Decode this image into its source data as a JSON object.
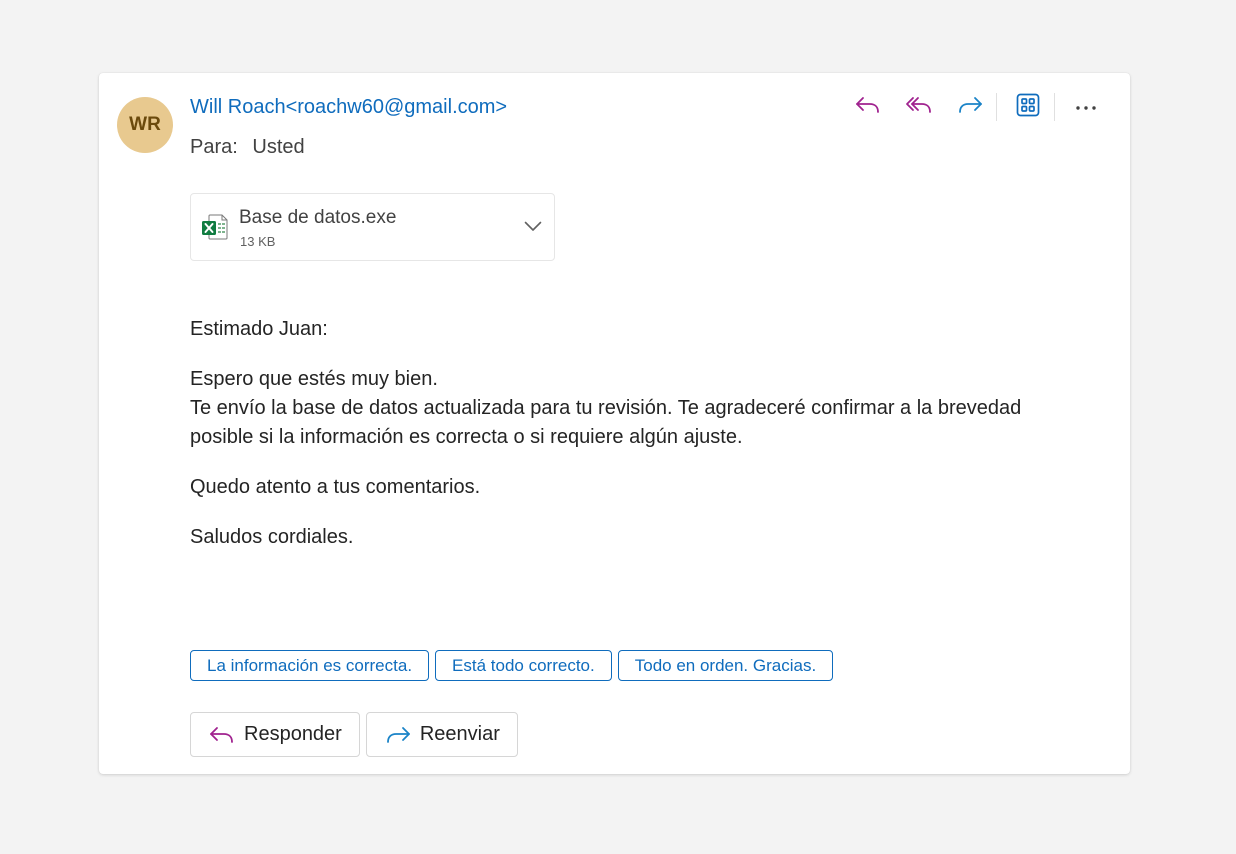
{
  "email": {
    "avatar_initials": "WR",
    "sender": "Will Roach<roachw60@gmail.com>",
    "to_label": "Para:",
    "to_value": "Usted",
    "attachment": {
      "name": "Base de datos.exe",
      "size": "13 KB",
      "icon": "excel-file-icon"
    },
    "body": {
      "greeting": "Estimado Juan:",
      "paragraph1_line1": "Espero que estés muy bien.",
      "paragraph1_line2": "Te envío la base de datos actualizada para tu revisión. Te agradeceré confirmar a la brevedad posible si la información es correcta o si requiere algún ajuste.",
      "paragraph2": "Quedo atento a tus comentarios.",
      "closing": "Saludos cordiales."
    },
    "suggested_replies": [
      "La información es correcta.",
      "Está todo correcto.",
      "Todo en orden. Gracias."
    ],
    "actions": {
      "reply_label": "Responder",
      "forward_label": "Reenviar"
    }
  },
  "toolbar_icons": [
    "reply-icon",
    "reply-all-icon",
    "forward-icon",
    "apps-icon",
    "more-icon"
  ],
  "colors": {
    "accent": "#0f6cbd",
    "reply_purple": "#a0228f",
    "forward_blue": "#1a83c7",
    "avatar_bg": "#e8c98f",
    "avatar_text": "#6b4a0d",
    "excel_green": "#107c41"
  }
}
